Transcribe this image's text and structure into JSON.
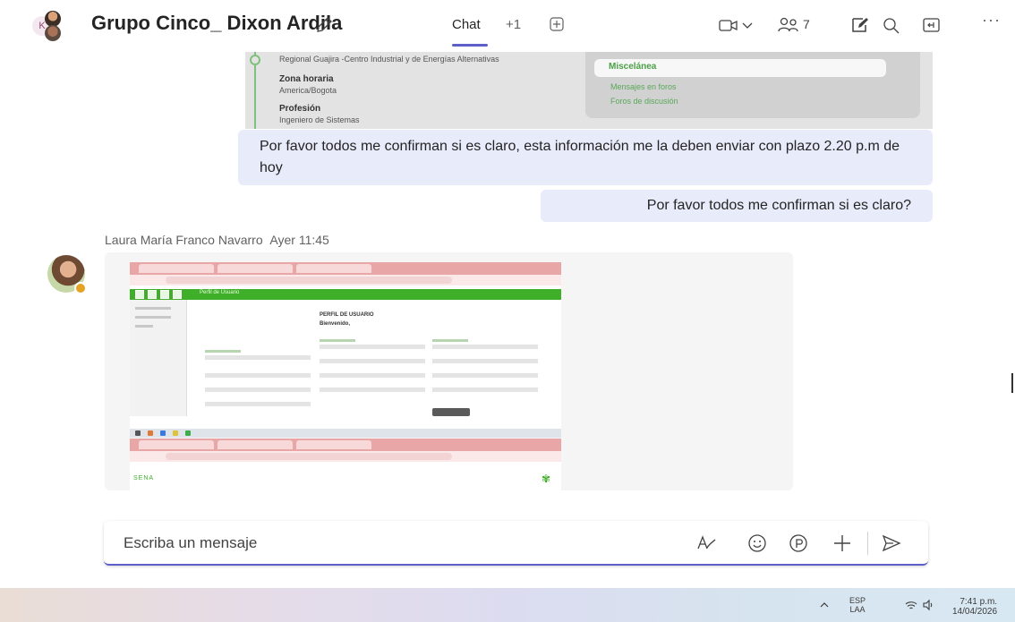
{
  "header": {
    "avatar_initial": "K",
    "title": "Grupo Cinco_ Dixon Ardila",
    "tab_chat": "Chat",
    "tab_more": "+1",
    "participants_count": "7"
  },
  "shared_profile": {
    "regional": "Regional Guajira -Centro Industrial y de Energías Alternativas",
    "timezone_label": "Zona horaria",
    "timezone_value": "America/Bogota",
    "profession_label": "Profesión",
    "profession_value": "Ingeniero de Sistemas",
    "misc_label": "Miscelánea",
    "misc_link_1": "Mensajes en foros",
    "misc_link_2": "Foros de discusión"
  },
  "messages": {
    "sent_1": "Por favor todos me confirman si es claro, esta información me la deben enviar con plazo 2.20 p.m de hoy",
    "sent_2": "Por favor todos me confirman si es claro?",
    "incoming_sender": "Laura María Franco Navarro",
    "incoming_time": "Ayer 11:45"
  },
  "nested_screenshot": {
    "page_title": "PERFIL DE USUARIO",
    "welcome": "Bienvenido,",
    "bottom_logo": "SENA",
    "bar_title": "Perfil de Usuario"
  },
  "compose": {
    "placeholder": "Escriba un mensaje"
  },
  "taskbar": {
    "lang": "ESP",
    "layout": "LAA",
    "time": "7:41 p.m.",
    "date": "14/04/2026"
  },
  "colors": {
    "accent": "#5b5fc7",
    "sent_bubble": "#e8ebfa",
    "incoming_bubble": "#f5f5f5",
    "sena_green": "#3fae29",
    "away_status": "#e5a223"
  },
  "icons": [
    "edit-icon",
    "add-tab-icon",
    "video-call-icon",
    "chevron-down-icon",
    "participants-icon",
    "notes-icon",
    "search-icon",
    "popout-icon",
    "more-icon",
    "format-icon",
    "emoji-icon",
    "loop-icon",
    "attach-icon",
    "send-icon",
    "chevron-up-icon",
    "wifi-icon",
    "speaker-icon"
  ]
}
